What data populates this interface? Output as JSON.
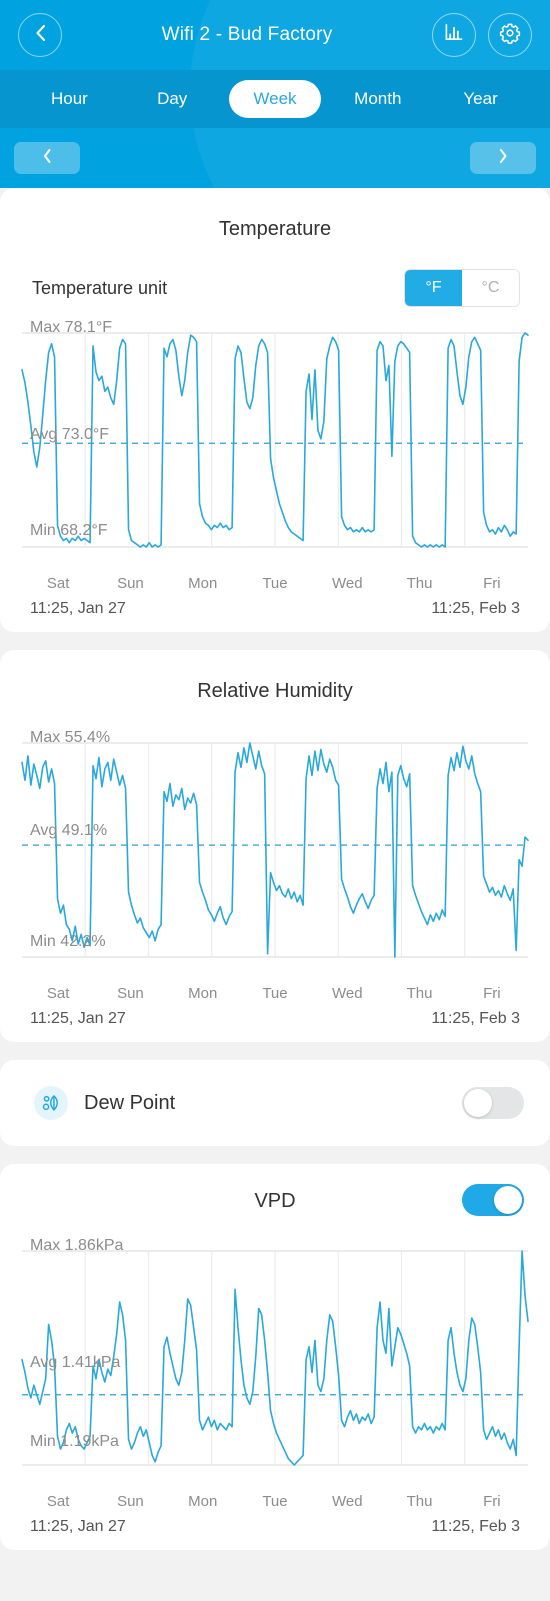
{
  "header": {
    "title": "Wifi 2 - Bud Factory",
    "back_icon": "chevron-left-icon",
    "chart_icon": "bar-chart-icon",
    "settings_icon": "gear-icon",
    "accent": "#00a2e0",
    "tabs_bg": "#0695cf"
  },
  "period_tabs": {
    "items": [
      {
        "label": "Hour",
        "active": false
      },
      {
        "label": "Day",
        "active": false
      },
      {
        "label": "Week",
        "active": true
      },
      {
        "label": "Month",
        "active": false
      },
      {
        "label": "Year",
        "active": false
      }
    ]
  },
  "pager": {
    "prev_icon": "chevron-left-icon",
    "next_icon": "chevron-right-icon"
  },
  "temperature": {
    "title": "Temperature",
    "unit_label": "Temperature unit",
    "unit_options": [
      {
        "label": "°F",
        "selected": true
      },
      {
        "label": "°C",
        "selected": false
      }
    ],
    "max_label": "Max 78.1°F",
    "avg_label": "Avg 73.0°F",
    "min_label": "Min 68.2°F",
    "start_time": "11:25,  Jan 27",
    "end_time": "11:25,  Feb 3",
    "days": [
      "Sat",
      "Sun",
      "Mon",
      "Tue",
      "Wed",
      "Thu",
      "Fri"
    ],
    "line_color": "#29a8db"
  },
  "humidity": {
    "title": "Relative Humidity",
    "max_label": "Max 55.4%",
    "avg_label": "Avg 49.1%",
    "min_label": "Min 42.2%",
    "start_time": "11:25,  Jan 27",
    "end_time": "11:25,  Feb 3",
    "days": [
      "Sat",
      "Sun",
      "Mon",
      "Tue",
      "Wed",
      "Thu",
      "Fri"
    ],
    "line_color": "#29a8db"
  },
  "dew_point": {
    "title": "Dew Point",
    "icon": "dew-drop-leaf-icon",
    "enabled": false
  },
  "vpd": {
    "title": "VPD",
    "enabled": true,
    "max_label": "Max 1.86kPa",
    "avg_label": "Avg 1.41kPa",
    "min_label": "Min 1.19kPa",
    "start_time": "11:25,  Jan 27",
    "end_time": "11:25,  Feb 3",
    "days": [
      "Sat",
      "Sun",
      "Mon",
      "Tue",
      "Wed",
      "Thu",
      "Fri"
    ],
    "line_color": "#29a8db"
  },
  "chart_data": [
    {
      "type": "line",
      "title": "Temperature",
      "xlabel": "",
      "ylabel": "°F",
      "ylim": [
        68.2,
        78.1
      ],
      "max": 78.1,
      "avg": 73.0,
      "min": 68.2,
      "unit": "°F",
      "x_start": "11:25, Jan 27",
      "x_end": "11:25, Feb 3",
      "tick_labels": [
        "Sat",
        "Sun",
        "Mon",
        "Tue",
        "Wed",
        "Thu",
        "Fri"
      ],
      "grid": true,
      "legend": "none",
      "avg_line": true,
      "values": [
        76.4,
        75.8,
        74.9,
        73.8,
        72.6,
        71.9,
        72.8,
        74.3,
        75.9,
        77.2,
        77.6,
        77.0,
        69.2,
        68.7,
        68.5,
        68.6,
        68.4,
        68.6,
        68.5,
        68.7,
        68.5,
        68.6,
        68.5,
        68.4,
        77.5,
        76.3,
        75.9,
        76.1,
        75.4,
        75.6,
        75.1,
        74.8,
        75.9,
        77.4,
        77.8,
        77.6,
        69.0,
        68.5,
        68.4,
        68.3,
        68.2,
        68.3,
        68.2,
        68.4,
        68.2,
        68.3,
        68.2,
        68.3,
        77.4,
        77.0,
        77.6,
        77.8,
        77.3,
        76.1,
        75.2,
        75.9,
        77.2,
        78.0,
        77.9,
        77.7,
        70.2,
        69.6,
        69.3,
        69.2,
        69.0,
        69.2,
        69.1,
        69.3,
        69.1,
        69.2,
        69.0,
        69.1,
        76.9,
        77.5,
        77.2,
        76.0,
        74.9,
        74.6,
        75.1,
        76.6,
        77.5,
        77.8,
        77.6,
        77.2,
        72.3,
        71.4,
        70.8,
        70.2,
        69.8,
        69.4,
        69.1,
        68.9,
        68.8,
        68.7,
        68.6,
        68.5,
        75.4,
        76.2,
        74.1,
        76.4,
        73.6,
        73.2,
        74.0,
        76.9,
        77.5,
        77.9,
        77.7,
        77.3,
        69.6,
        69.2,
        69.0,
        69.1,
        68.9,
        69.0,
        68.9,
        69.1,
        68.9,
        69.0,
        68.9,
        69.0,
        77.3,
        77.7,
        77.5,
        75.9,
        76.6,
        72.4,
        76.8,
        77.5,
        77.7,
        77.6,
        77.4,
        77.2,
        68.7,
        68.4,
        68.3,
        68.2,
        68.3,
        68.2,
        68.3,
        68.2,
        68.3,
        68.2,
        68.3,
        68.2,
        77.4,
        77.8,
        77.5,
        76.3,
        75.2,
        74.8,
        75.6,
        77.0,
        77.7,
        77.9,
        77.6,
        77.3,
        69.8,
        69.2,
        68.9,
        69.0,
        68.8,
        69.1,
        68.9,
        69.2,
        69.0,
        68.7,
        68.9,
        68.8,
        76.8,
        77.9,
        78.1,
        78.0
      ]
    },
    {
      "type": "line",
      "title": "Relative Humidity",
      "xlabel": "",
      "ylabel": "%",
      "ylim": [
        42.2,
        55.4
      ],
      "max": 55.4,
      "avg": 49.1,
      "min": 42.2,
      "unit": "%",
      "x_start": "11:25, Jan 27",
      "x_end": "11:25, Feb 3",
      "tick_labels": [
        "Sat",
        "Sun",
        "Mon",
        "Tue",
        "Wed",
        "Thu",
        "Fri"
      ],
      "grid": true,
      "legend": "none",
      "avg_line": true,
      "values": [
        54.2,
        53.1,
        54.6,
        52.8,
        54.1,
        53.4,
        52.6,
        53.9,
        54.3,
        53.0,
        53.8,
        52.9,
        45.8,
        44.9,
        45.4,
        44.2,
        43.9,
        43.2,
        44.1,
        43.0,
        43.6,
        42.8,
        43.4,
        42.9,
        54.0,
        53.2,
        54.5,
        52.7,
        53.8,
        54.2,
        53.1,
        54.4,
        53.6,
        52.8,
        53.4,
        52.6,
        46.2,
        45.4,
        44.8,
        44.3,
        44.6,
        44.0,
        43.7,
        43.4,
        43.8,
        43.2,
        43.9,
        44.2,
        52.4,
        51.8,
        52.9,
        51.5,
        52.2,
        51.9,
        52.6,
        51.3,
        52.0,
        51.7,
        52.3,
        51.6,
        46.8,
        46.2,
        45.7,
        45.1,
        44.8,
        44.4,
        44.9,
        45.3,
        44.6,
        44.2,
        44.7,
        45.0,
        53.6,
        54.8,
        53.9,
        55.1,
        54.2,
        55.4,
        54.6,
        53.8,
        54.9,
        54.0,
        53.5,
        42.4,
        47.4,
        46.8,
        46.3,
        46.6,
        46.1,
        45.9,
        46.4,
        45.8,
        46.2,
        45.6,
        46.0,
        45.4,
        53.2,
        54.6,
        53.4,
        54.9,
        53.7,
        55.0,
        54.1,
        53.6,
        54.4,
        53.9,
        53.1,
        52.8,
        47.0,
        46.4,
        45.9,
        45.3,
        44.9,
        45.4,
        45.8,
        46.1,
        45.6,
        45.2,
        45.7,
        46.0,
        52.6,
        53.8,
        52.9,
        54.2,
        52.4,
        53.6,
        42.2,
        53.4,
        54.0,
        53.2,
        52.7,
        53.5,
        46.6,
        46.0,
        45.5,
        45.0,
        44.6,
        44.2,
        44.8,
        44.4,
        44.9,
        44.5,
        45.1,
        44.7,
        53.4,
        54.5,
        53.7,
        54.8,
        53.9,
        55.2,
        54.3,
        53.8,
        54.6,
        53.5,
        52.9,
        52.4,
        47.2,
        46.7,
        46.2,
        46.5,
        46.0,
        46.3,
        45.9,
        46.6,
        46.1,
        45.7,
        46.4,
        42.6,
        48.2,
        47.8,
        49.6,
        49.4
      ]
    },
    {
      "type": "line",
      "title": "VPD",
      "xlabel": "",
      "ylabel": "kPa",
      "ylim": [
        1.19,
        1.86
      ],
      "max": 1.86,
      "avg": 1.41,
      "min": 1.19,
      "unit": "kPa",
      "x_start": "11:25, Jan 27",
      "x_end": "11:25, Feb 3",
      "tick_labels": [
        "Sat",
        "Sun",
        "Mon",
        "Tue",
        "Wed",
        "Thu",
        "Fri"
      ],
      "grid": true,
      "legend": "none",
      "avg_line": true,
      "values": [
        1.52,
        1.48,
        1.43,
        1.4,
        1.44,
        1.41,
        1.38,
        1.42,
        1.46,
        1.63,
        1.58,
        1.5,
        1.28,
        1.24,
        1.26,
        1.3,
        1.32,
        1.29,
        1.31,
        1.27,
        1.25,
        1.24,
        1.26,
        1.28,
        1.5,
        1.46,
        1.52,
        1.48,
        1.45,
        1.49,
        1.47,
        1.53,
        1.6,
        1.7,
        1.66,
        1.58,
        1.27,
        1.24,
        1.26,
        1.29,
        1.31,
        1.28,
        1.3,
        1.26,
        1.22,
        1.2,
        1.23,
        1.25,
        1.56,
        1.59,
        1.54,
        1.5,
        1.46,
        1.44,
        1.48,
        1.58,
        1.71,
        1.69,
        1.62,
        1.55,
        1.33,
        1.3,
        1.32,
        1.34,
        1.31,
        1.33,
        1.3,
        1.32,
        1.31,
        1.3,
        1.32,
        1.31,
        1.74,
        1.62,
        1.52,
        1.44,
        1.4,
        1.38,
        1.42,
        1.53,
        1.68,
        1.66,
        1.58,
        1.48,
        1.36,
        1.32,
        1.29,
        1.27,
        1.25,
        1.23,
        1.21,
        1.2,
        1.19,
        1.2,
        1.21,
        1.22,
        1.52,
        1.56,
        1.48,
        1.58,
        1.44,
        1.42,
        1.46,
        1.58,
        1.66,
        1.64,
        1.56,
        1.47,
        1.33,
        1.31,
        1.34,
        1.36,
        1.33,
        1.35,
        1.32,
        1.34,
        1.33,
        1.35,
        1.32,
        1.34,
        1.62,
        1.7,
        1.58,
        1.54,
        1.68,
        1.5,
        1.56,
        1.62,
        1.6,
        1.57,
        1.54,
        1.5,
        1.31,
        1.29,
        1.31,
        1.3,
        1.32,
        1.3,
        1.31,
        1.29,
        1.31,
        1.3,
        1.32,
        1.3,
        1.58,
        1.62,
        1.54,
        1.48,
        1.44,
        1.42,
        1.46,
        1.58,
        1.65,
        1.63,
        1.56,
        1.48,
        1.3,
        1.27,
        1.29,
        1.31,
        1.28,
        1.3,
        1.27,
        1.29,
        1.26,
        1.24,
        1.27,
        1.22,
        1.56,
        1.86,
        1.72,
        1.64
      ]
    }
  ]
}
